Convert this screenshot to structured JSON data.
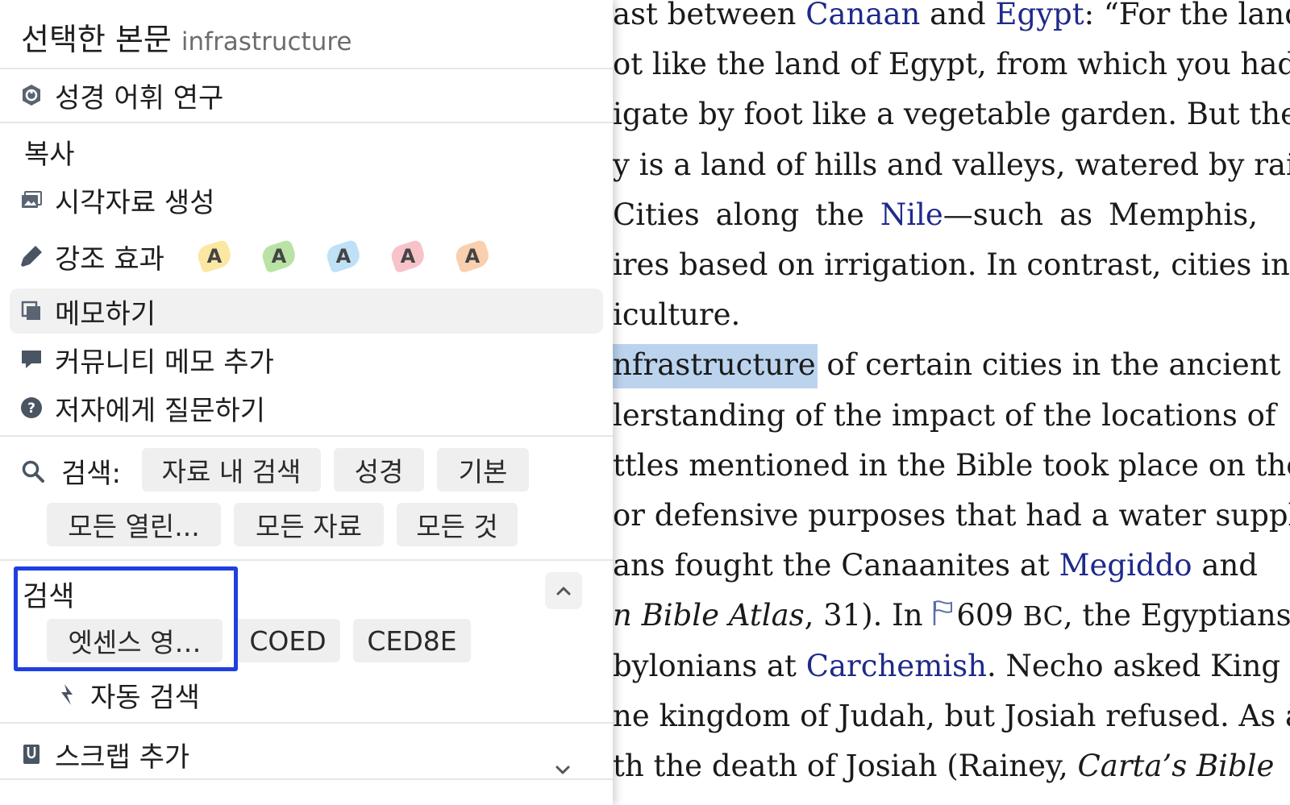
{
  "reader": {
    "lines": [
      [
        {
          "t": "ast between "
        },
        {
          "t": "Canaan",
          "link": true
        },
        {
          "t": " and "
        },
        {
          "t": "Egypt",
          "link": true
        },
        {
          "t": ": “For the land"
        }
      ],
      [
        {
          "t": "ot like the land of Egypt, from which you had"
        }
      ],
      [
        {
          "t": "igate by foot like a vegetable garden. But the"
        }
      ],
      [
        {
          "t": "y is a land of hills and valleys, watered by rain"
        }
      ],
      [
        {
          "t": " Cities along the "
        },
        {
          "t": "Nile",
          "link": true
        },
        {
          "t": "—such as Memphis,"
        }
      ],
      [
        {
          "t": "ires based on irrigation. In contrast, cities in"
        }
      ],
      [
        {
          "t": "iculture."
        }
      ],
      [
        {
          "t": "nfrastructure",
          "hl": true
        },
        {
          "t": " of certain cities in the ancient"
        }
      ],
      [
        {
          "t": "lerstanding of the impact of the locations of"
        }
      ],
      [
        {
          "t": "ttles mentioned in the Bible took place on the"
        }
      ],
      [
        {
          "t": "or defensive purposes that had a water supply."
        }
      ],
      [
        {
          "t": "ans fought the Canaanites at "
        },
        {
          "t": "Megiddo",
          "link": true
        },
        {
          "t": " and"
        }
      ],
      [
        {
          "t": "n Bible Atlas",
          "it": true
        },
        {
          "t": ", 31). In "
        },
        {
          "flag": true
        },
        {
          "t": "609 "
        },
        {
          "t": "BC",
          "sc": true
        },
        {
          "t": ", the Egyptians,"
        }
      ],
      [
        {
          "t": "bylonians at "
        },
        {
          "t": "Carchemish",
          "link": true
        },
        {
          "t": ". Necho asked King"
        }
      ],
      [
        {
          "t": "ne kingdom of Judah, but Josiah refused. As a"
        }
      ],
      [
        {
          "t": "th the death of Josiah (Rainey, "
        },
        {
          "t": "Carta’s Bible",
          "it": true
        }
      ]
    ]
  },
  "menu": {
    "header_title": "선택한 본문",
    "selected_text": "infrastructure",
    "word_study": "성경 어휘 연구",
    "copy": "복사",
    "visual_copy": "시각자료 생성",
    "highlight": "강조 효과",
    "highlight_swatches": [
      {
        "letter": "A",
        "color": "#fbe7a1"
      },
      {
        "letter": "A",
        "color": "#b9e3a4"
      },
      {
        "letter": "A",
        "color": "#bfe0f7"
      },
      {
        "letter": "A",
        "color": "#f7c3c9"
      },
      {
        "letter": "A",
        "color": "#f9cfae"
      }
    ],
    "take_note": "메모하기",
    "community_note": "커뮤니티 메모 추가",
    "ask_author": "저자에게 질문하기"
  },
  "search": {
    "label": "검색:",
    "row1": [
      "자료 내 검색",
      "성경",
      "기본"
    ],
    "row2": [
      "모든 열린...",
      "모든 자료",
      "모든 것"
    ]
  },
  "lookup": {
    "title": "검색",
    "chips": [
      "엣센스 영…",
      "COED",
      "CED8E"
    ],
    "auto_lookup": "자동 검색"
  },
  "scrap": {
    "label": "스크랩 추가"
  },
  "colors": {
    "link": "#1f2a8a",
    "selection": "#bcd3ee",
    "focus": "#1f3fe0",
    "icon": "#4a5563"
  }
}
